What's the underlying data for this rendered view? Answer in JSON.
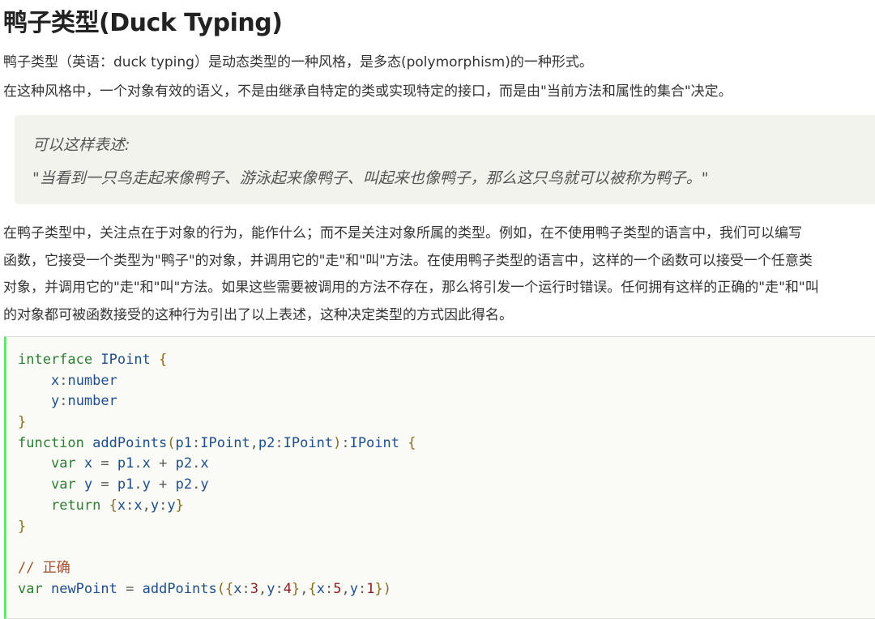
{
  "title": "鸭子类型(Duck Typing)",
  "intro": [
    "鸭子类型（英语：duck typing）是动态类型的一种风格，是多态(polymorphism)的一种形式。",
    "在这种风格中，一个对象有效的语义，不是由继承自特定的类或实现特定的接口，而是由\"当前方法和属性的集合\"决定。"
  ],
  "quote": {
    "lead": "可以这样表述:",
    "text": "\"当看到一只鸟走起来像鸭子、游泳起来像鸭子、叫起来也像鸭子，那么这只鸟就可以被称为鸭子。\""
  },
  "explanation": [
    "在鸭子类型中，关注点在于对象的行为，能作什么；而不是关注对象所属的类型。例如，在不使用鸭子类型的语言中，我们可以编写",
    "函数，它接受一个类型为\"鸭子\"的对象，并调用它的\"走\"和\"叫\"方法。在使用鸭子类型的语言中，这样的一个函数可以接受一个任意类",
    "对象，并调用它的\"走\"和\"叫\"方法。如果这些需要被调用的方法不存在，那么将引发一个运行时错误。任何拥有这样的正确的\"走\"和\"叫",
    "的对象都可被函数接受的这种行为引出了以上表述，这种决定类型的方式因此得名。"
  ],
  "code": {
    "language": "typescript",
    "lines": [
      "interface IPoint {",
      "    x:number",
      "    y:number",
      "}",
      "function addPoints(p1:IPoint,p2:IPoint):IPoint {",
      "    var x = p1.x + p2.x",
      "    var y = p1.y + p2.y",
      "    return {x:x,y:y}",
      "}",
      "",
      "// 正确",
      "var newPoint = addPoints({x:3,y:4},{x:5,y:1})"
    ]
  }
}
